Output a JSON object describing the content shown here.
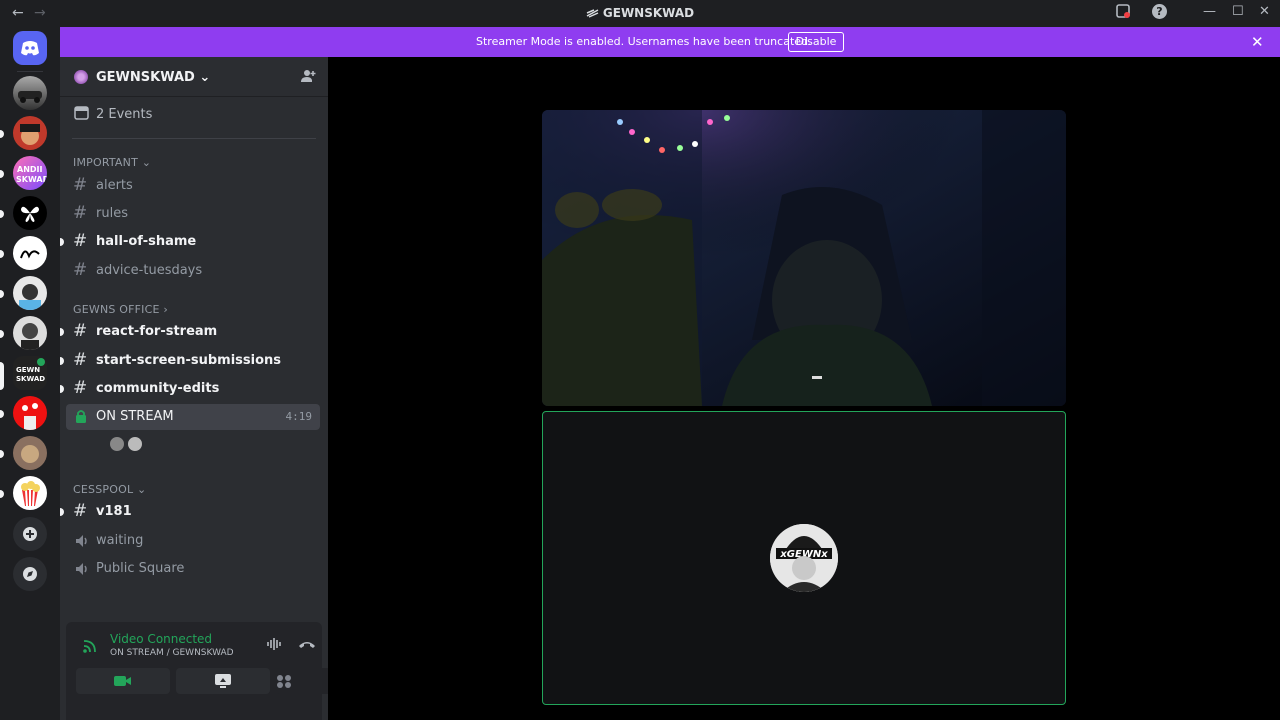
{
  "titlebar": {
    "back": "←",
    "forward": "→",
    "title": "GEWNSKWAD",
    "minimize": "—",
    "maximize": "☐",
    "close": "✕",
    "help": "?"
  },
  "banner": {
    "text": "Streamer Mode is enabled. Usernames have been truncated.",
    "button": "Disable",
    "close": "✕"
  },
  "guild": {
    "name": "GEWNSKWAD",
    "chevron": "⌄",
    "events": "2 Events"
  },
  "categories": {
    "important": "IMPORTANT",
    "important_chev": "⌄",
    "office": "GEWNS OFFICE",
    "office_chev": "›",
    "cesspool": "CESSPOOL",
    "cesspool_chev": "⌄"
  },
  "channels": {
    "alerts": "alerts",
    "rules": "rules",
    "hall": "hall-of-shame",
    "advice": "advice-tuesdays",
    "react": "react-for-stream",
    "start": "start-screen-submissions",
    "community": "community-edits",
    "on_stream": "ON STREAM",
    "on_stream_time": "4:19",
    "v181": "v181",
    "waiting": "waiting",
    "public": "Public Square"
  },
  "hash": "#",
  "voice_panel": {
    "status": "Video Connected",
    "location": "ON STREAM / GEWNSKWAD"
  },
  "avatar_text": "xGEWNx",
  "colors": {
    "banner": "#8f3df0",
    "connected": "#23a55a",
    "sidebar": "#2b2d31",
    "rail": "#1e1f22"
  }
}
